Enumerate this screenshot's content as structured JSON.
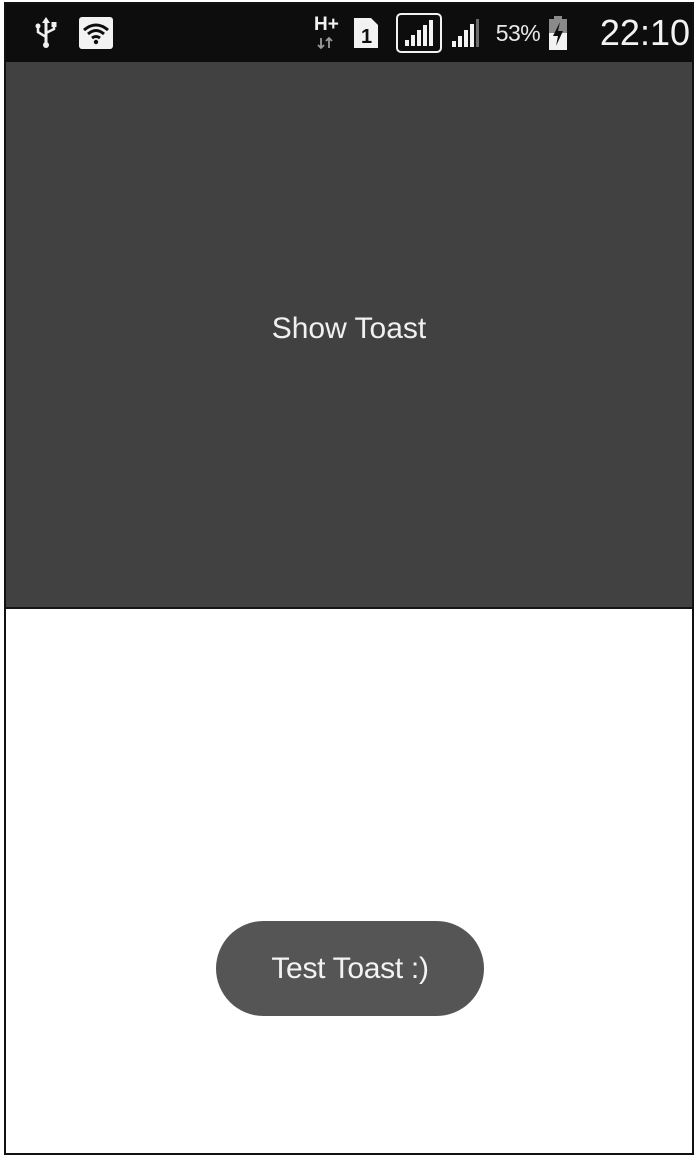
{
  "status_bar": {
    "icons": {
      "usb": "usb-icon",
      "wifi": "wifi-icon",
      "network_type": "H+",
      "sim_slot": "1",
      "signal_primary": "signal-strength-icon",
      "signal_secondary": "signal-strength-icon",
      "battery": "battery-charging-icon"
    },
    "battery_percent": "53%",
    "time": "22:10"
  },
  "main": {
    "button_label": "Show Toast"
  },
  "toast": {
    "message": "Test Toast :)"
  },
  "colors": {
    "status_bar_bg": "#0d0d0d",
    "button_bg": "#414141",
    "toast_bg": "#555555",
    "screen_bg": "#ffffff"
  }
}
